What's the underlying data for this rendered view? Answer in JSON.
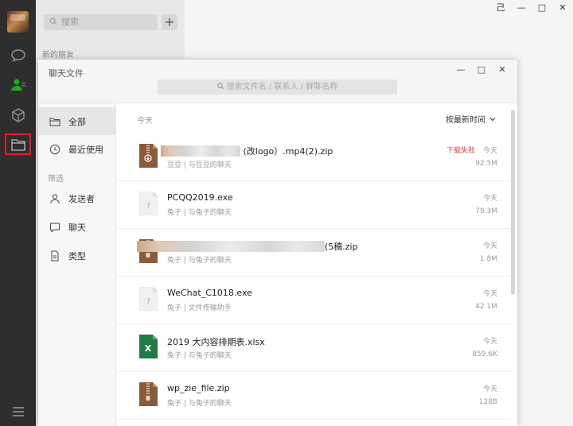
{
  "window": {
    "controls": [
      "⼰",
      "—",
      "□",
      "✕"
    ]
  },
  "chatlist": {
    "search_placeholder": "搜索",
    "add_label": "+",
    "section_title": "新的朋友"
  },
  "dialog": {
    "title": "聊天文件",
    "controls": [
      "—",
      "□",
      "✕"
    ],
    "search_placeholder": "搜索文件名 / 联系人 / 群聊名称",
    "sidebar": {
      "all_label": "全部",
      "recent_label": "最近使用",
      "filter_label": "筛选",
      "sender_label": "发送者",
      "chat_label": "聊天",
      "type_label": "类型"
    },
    "list": {
      "section": "今天",
      "sort_label": "按最新时间",
      "files": [
        {
          "name": "(改logo）.mp4(2).zip",
          "sub": "豆豆 | 与豆豆的聊天",
          "status": "下载失败",
          "date": "今天",
          "size": "92.5M",
          "icon": "zip-icon"
        },
        {
          "name": "PCQQ2019.exe",
          "sub": "兔子 | 与兔子的聊天",
          "status": "",
          "date": "今天",
          "size": "79.3M",
          "icon": "unknown-file-icon"
        },
        {
          "name": "(5稿.zip",
          "sub": "兔子 | 与兔子的聊天",
          "status": "",
          "date": "今天",
          "size": "1.8M",
          "icon": "zip-icon"
        },
        {
          "name": "WeChat_C1018.exe",
          "sub": "兔子 | 文件传输助手",
          "status": "",
          "date": "今天",
          "size": "42.1M",
          "icon": "unknown-file-icon"
        },
        {
          "name": "2019 大内容排期表.xlsx",
          "sub": "兔子 | 与兔子的聊天",
          "status": "",
          "date": "今天",
          "size": "859.6K",
          "icon": "excel-icon"
        },
        {
          "name": "wp_zie_file.zip",
          "sub": "兔子 | 与兔子的聊天",
          "status": "",
          "date": "今天",
          "size": "128B",
          "icon": "zip-icon"
        }
      ]
    }
  }
}
